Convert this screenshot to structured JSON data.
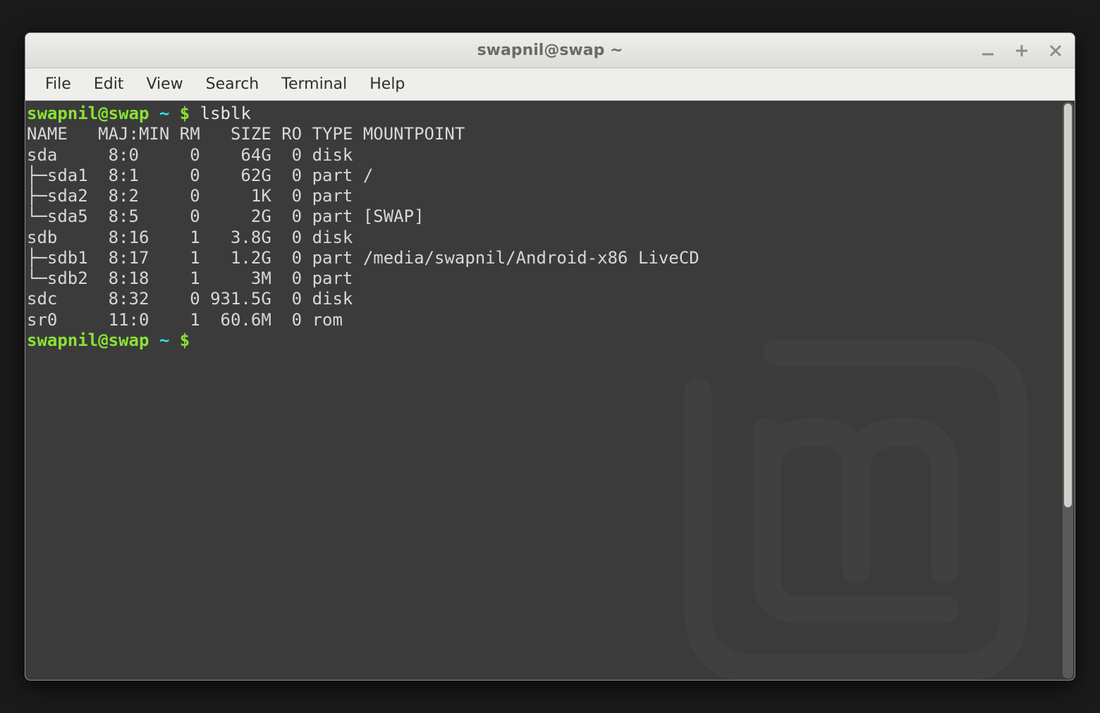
{
  "window": {
    "title": "swapnil@swap ~"
  },
  "menubar": {
    "items": [
      "File",
      "Edit",
      "View",
      "Search",
      "Terminal",
      "Help"
    ]
  },
  "terminal": {
    "prompt_user_host": "swapnil@swap",
    "prompt_path": "~",
    "prompt_symbol": "$",
    "command": "lsblk",
    "headers": {
      "name": "NAME",
      "majmin": "MAJ:MIN",
      "rm": "RM",
      "size": "SIZE",
      "ro": "RO",
      "type": "TYPE",
      "mountpoint": "MOUNTPOINT"
    },
    "rows": [
      {
        "tree": "sda   ",
        "majmin": "8:0  ",
        "rm": "0",
        "size": "   64G",
        "ro": "0",
        "type": "disk",
        "mount": ""
      },
      {
        "tree": "├─sda1",
        "majmin": "8:1  ",
        "rm": "0",
        "size": "   62G",
        "ro": "0",
        "type": "part",
        "mount": "/"
      },
      {
        "tree": "├─sda2",
        "majmin": "8:2  ",
        "rm": "0",
        "size": "    1K",
        "ro": "0",
        "type": "part",
        "mount": ""
      },
      {
        "tree": "└─sda5",
        "majmin": "8:5  ",
        "rm": "0",
        "size": "    2G",
        "ro": "0",
        "type": "part",
        "mount": "[SWAP]"
      },
      {
        "tree": "sdb   ",
        "majmin": "8:16 ",
        "rm": "1",
        "size": "  3.8G",
        "ro": "0",
        "type": "disk",
        "mount": ""
      },
      {
        "tree": "├─sdb1",
        "majmin": "8:17 ",
        "rm": "1",
        "size": "  1.2G",
        "ro": "0",
        "type": "part",
        "mount": "/media/swapnil/Android-x86 LiveCD"
      },
      {
        "tree": "└─sdb2",
        "majmin": "8:18 ",
        "rm": "1",
        "size": "    3M",
        "ro": "0",
        "type": "part",
        "mount": ""
      },
      {
        "tree": "sdc   ",
        "majmin": "8:32 ",
        "rm": "0",
        "size": "931.5G",
        "ro": "0",
        "type": "disk",
        "mount": ""
      },
      {
        "tree": "sr0   ",
        "majmin": "11:0 ",
        "rm": "1",
        "size": " 60.6M",
        "ro": "0",
        "type": "rom ",
        "mount": ""
      }
    ]
  }
}
